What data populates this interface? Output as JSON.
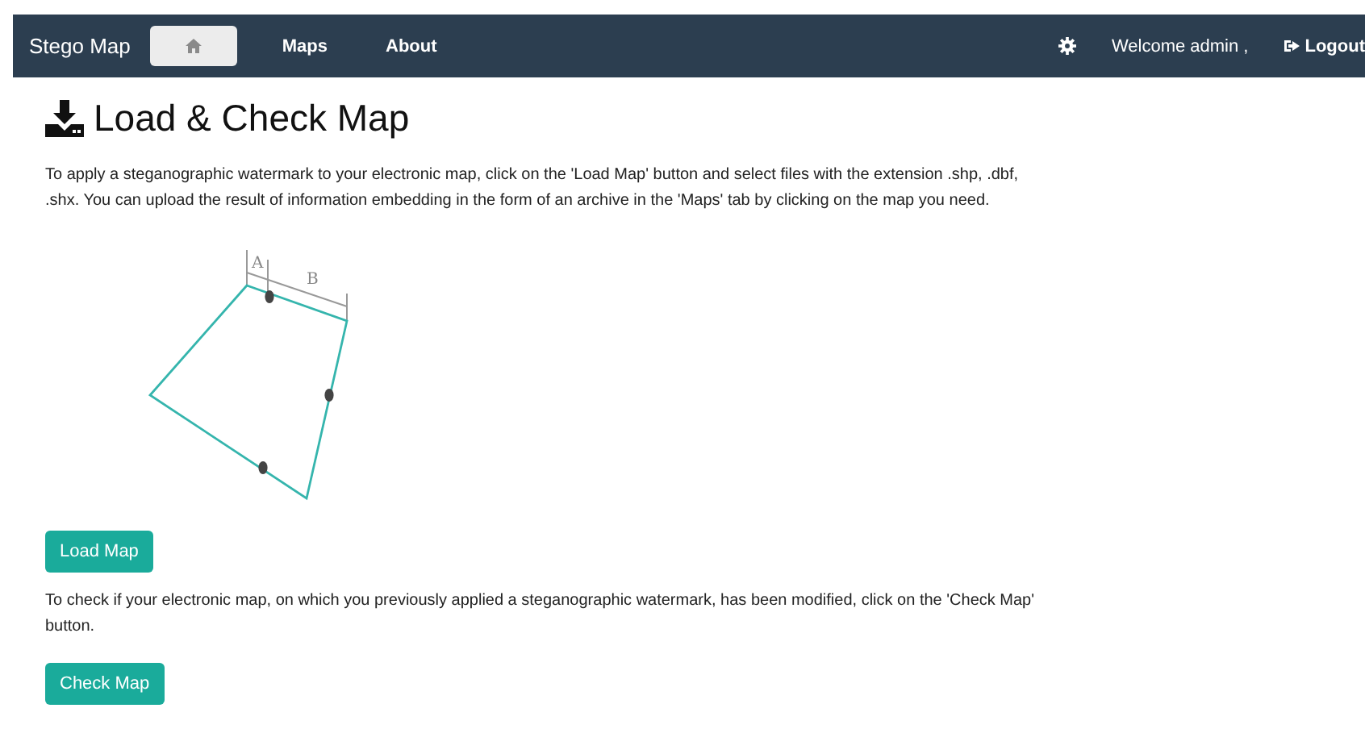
{
  "navbar": {
    "brand": "Stego Map",
    "items": [
      {
        "kind": "home",
        "selected": true
      },
      {
        "kind": "link",
        "label": "Maps",
        "selected": false
      },
      {
        "kind": "link",
        "label": "About",
        "selected": false
      }
    ],
    "welcome": "Welcome admin ,",
    "logout": "Logout"
  },
  "title": "Load & Check Map",
  "intro": "To apply a steganographic watermark to your electronic map, click on the 'Load Map' button and select files with the extension .shp, .dbf, .shx. You can upload the result of information embedding in the form of an archive in the 'Maps' tab by clicking on the map you need.",
  "diagram": {
    "labels": [
      "A",
      "B"
    ]
  },
  "load_button": "Load Map",
  "check_text": "To check if your electronic map, on which you previously applied a steganographic watermark, has been modified, click on the 'Check Map' button.",
  "check_button": "Check Map"
}
